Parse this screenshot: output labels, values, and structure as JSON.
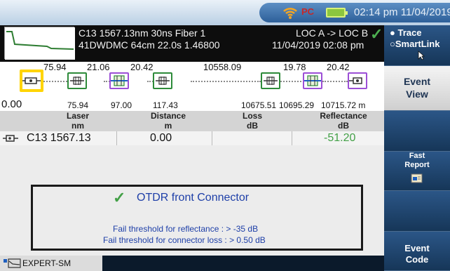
{
  "status": {
    "clock": "02:14 pm 11/04/2019",
    "logo": "PC"
  },
  "header": {
    "line1_left": "C13 1567.13nm 30ns Fiber 1",
    "line2_left": "41DWDMC 64cm 22.0s 1.46800",
    "line1_right": "LOC A -> LOC B",
    "line2_right": "11/04/2019  02:08 pm"
  },
  "linkmap": {
    "top_labels": [
      "75.94",
      "21.06",
      "20.42",
      "10558.09",
      "19.78",
      "20.42"
    ],
    "bottom_labels": [
      "0.00",
      "75.94",
      "97.00",
      "117.43",
      "10675.51",
      "10695.29",
      "10715.72 m"
    ]
  },
  "table": {
    "headers": {
      "laser": "Laser",
      "laser_unit": "nm",
      "distance": "Distance",
      "distance_unit": "m",
      "loss": "Loss",
      "loss_unit": "dB",
      "reflectance": "Reflectance",
      "reflectance_unit": "dB"
    },
    "row": {
      "laser": "C13 1567.13",
      "distance": "0.00",
      "loss": "",
      "reflectance": "-51.20"
    }
  },
  "message": {
    "title": "OTDR front Connector",
    "line1": "Fail threshold for reflectance : > -35 dB",
    "line2": "Fail threshold for connector loss : > 0.50 dB"
  },
  "bottom": {
    "mode": "EXPERT-SM"
  },
  "sidemenu": {
    "trace": "Trace",
    "smartlink": "SmartLink",
    "event_view_1": "Event",
    "event_view_2": "View",
    "fast_report_1": "Fast",
    "fast_report_2": "Report",
    "event_code_1": "Event",
    "event_code_2": "Code"
  },
  "colors": {
    "pass": "#43a047",
    "selected": "#ffd400",
    "message_text": "#1e3fa8"
  }
}
